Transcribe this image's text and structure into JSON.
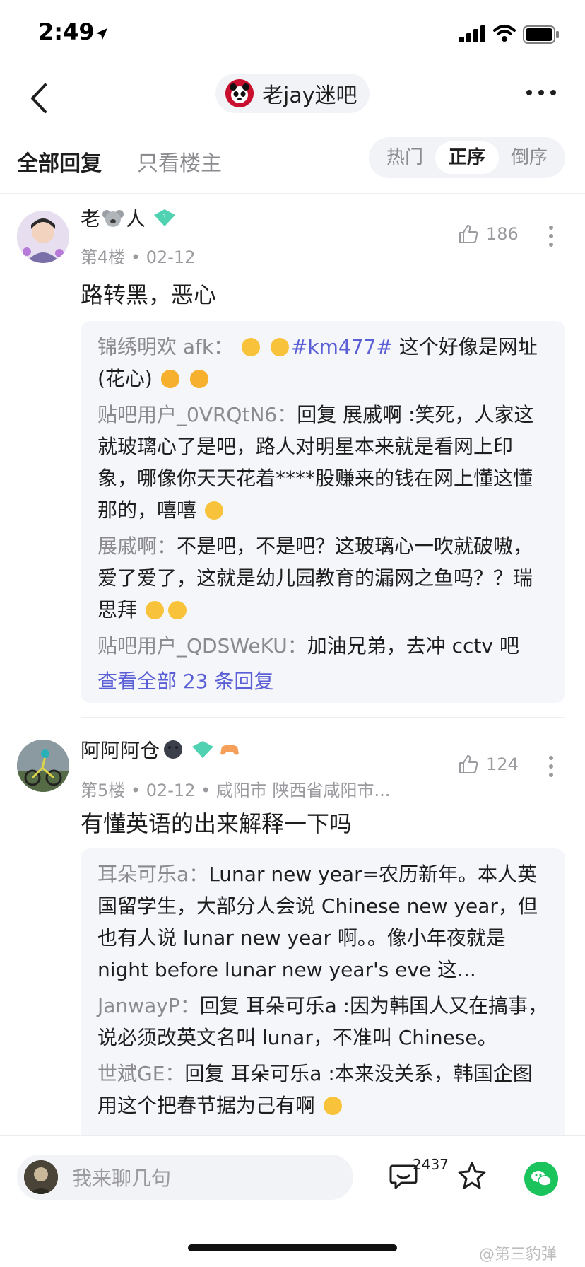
{
  "status_bar": {
    "time": "2:49"
  },
  "nav": {
    "forum_name": "老jay迷吧"
  },
  "tabs": {
    "all_replies": "全部回复",
    "op_only": "只看楼主"
  },
  "sort": {
    "options": [
      "热门",
      "正序",
      "倒序"
    ],
    "selected": "正序"
  },
  "posts": [
    {
      "username": "老",
      "username_suffix": "人",
      "floor": "第4楼",
      "date": "02-12",
      "location": "",
      "likes": "186",
      "content": "路转黑，恶心",
      "replies": [
        {
          "user": "锦绣明欢 afk",
          "text_a": "",
          "hashtag": "#km477#",
          "text_b": " 这个好像是网址(花心) "
        },
        {
          "user": "贴吧用户_0VRQtN6",
          "text": "回复 展戚啊 :笑死，人家这就玻璃心了是吧，路人对明星本来就是看网上印象，哪像你天天花着****股赚来的钱在网上懂这懂那的，嘻嘻 "
        },
        {
          "user": "展戚啊",
          "text": "不是吧，不是吧？这玻璃心一吹就破嗷，爱了爱了，这就是幼儿园教育的漏网之鱼吗？？瑞思拜 "
        },
        {
          "user": "贴吧用户_QDSWeKU",
          "text": "加油兄弟，去冲 cctv 吧"
        }
      ],
      "view_all": "查看全部 23 条回复"
    },
    {
      "username": "阿阿阿仓",
      "floor": "第5楼",
      "date": "02-12",
      "location": "咸阳市 陕西省咸阳市...",
      "likes": "124",
      "content": "有懂英语的出来解释一下吗",
      "replies": [
        {
          "user": "耳朵可乐a",
          "text": "Lunar new year=农历新年。本人英国留学生，大部分人会说 Chinese new year，但也有人说 lunar new year 啊。。像小年夜就是 night before lunar new year's eve 这..."
        },
        {
          "user": "JanwayP",
          "text": "回复 耳朵可乐a :因为韩国人又在搞事，说必须改英文名叫 lunar，不准叫 Chinese。"
        },
        {
          "user": "世斌GE",
          "text": "回复 耳朵可乐a :本来没关系，韩国企图用这个把春节据为己有啊 "
        }
      ]
    }
  ],
  "bottom_bar": {
    "placeholder": "我来聊几句",
    "comment_count": "2437"
  },
  "watermark": "@第三豹弹",
  "colors": {
    "link": "#5a5fd6",
    "wechat": "#1bc35d",
    "muted": "#8a8a8f"
  }
}
